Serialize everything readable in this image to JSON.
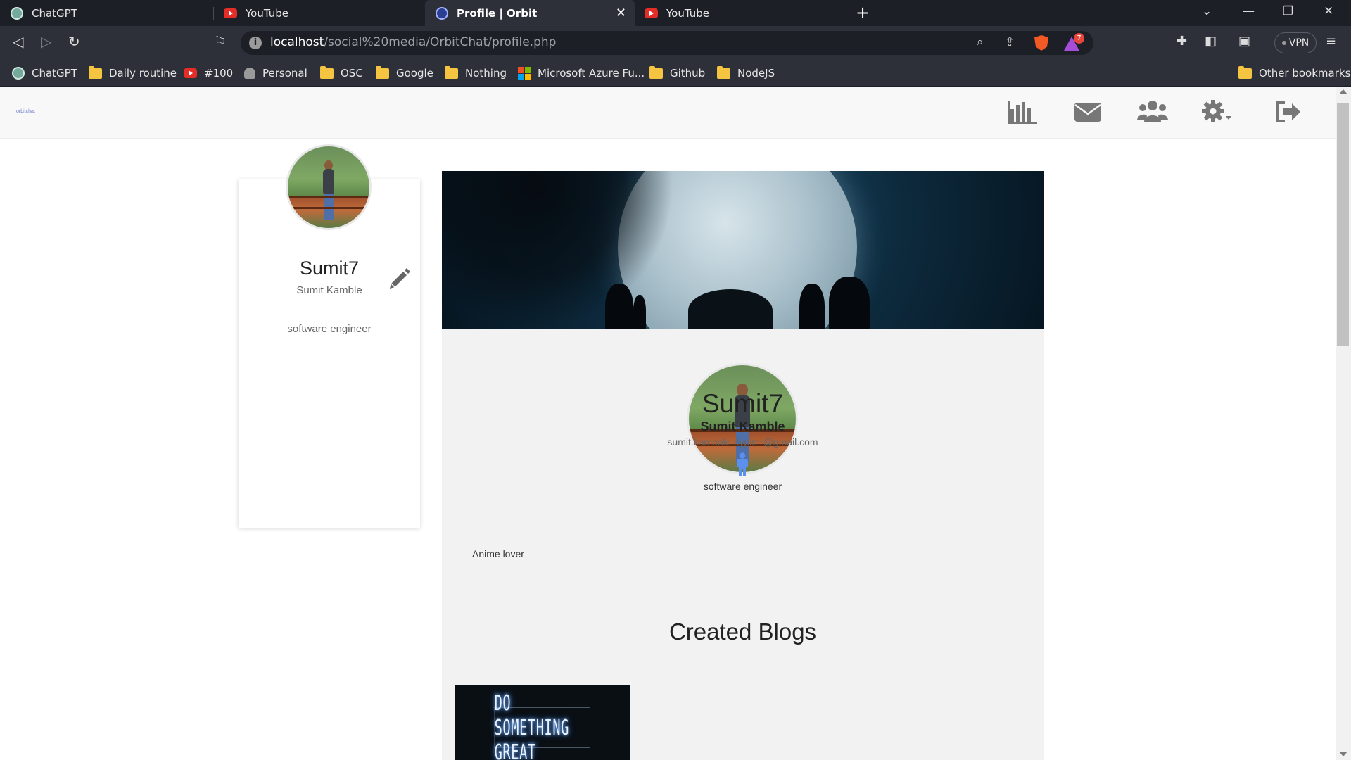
{
  "browser": {
    "tabs": [
      {
        "title": "ChatGPT",
        "icon": "chatgpt-icon"
      },
      {
        "title": "YouTube",
        "icon": "youtube-icon"
      },
      {
        "title": "Profile | Orbit",
        "icon": "orbit-icon",
        "active": true
      },
      {
        "title": "YouTube",
        "icon": "youtube-icon"
      }
    ],
    "url_host": "localhost",
    "url_path": "/social%20media/OrbitChat/profile.php",
    "rewards_badge": "7",
    "vpn_label": "VPN",
    "bookmarks": [
      {
        "label": "ChatGPT",
        "icon": "chatgpt-icon"
      },
      {
        "label": "Daily routine",
        "icon": "folder-icon"
      },
      {
        "label": "#100",
        "icon": "youtube-icon"
      },
      {
        "label": "Personal",
        "icon": "person-icon"
      },
      {
        "label": "OSC",
        "icon": "folder-icon"
      },
      {
        "label": "Google",
        "icon": "folder-icon"
      },
      {
        "label": "Nothing",
        "icon": "folder-icon"
      },
      {
        "label": "Microsoft Azure Fu...",
        "icon": "microsoft-icon"
      },
      {
        "label": "Github",
        "icon": "folder-icon"
      },
      {
        "label": "NodeJS",
        "icon": "folder-icon"
      }
    ],
    "other_bookmarks": "Other bookmarks"
  },
  "app": {
    "logo": "orbitchat",
    "nav_icons": [
      "bar-chart-icon",
      "envelope-icon",
      "users-icon",
      "gear-icon",
      "sign-out-icon"
    ]
  },
  "sidebar_profile": {
    "username": "Sumit7",
    "full_name": "Sumit Kamble",
    "bio": "software engineer"
  },
  "main_profile": {
    "username": "Sumit7",
    "full_name": "Sumit Kamble",
    "email": "sumit.kambale.dypimr@gmail.com",
    "gender_icon": "male-icon",
    "bio": "software engineer",
    "about": "Anime lover"
  },
  "blogs": {
    "heading": "Created Blogs",
    "items": [
      {
        "image_text": "DO SOMETHING GREAT"
      }
    ]
  },
  "colors": {
    "accent_blue": "#5b8ff0",
    "nav_icon_gray": "#777777",
    "card_bg": "#f2f2f2"
  }
}
